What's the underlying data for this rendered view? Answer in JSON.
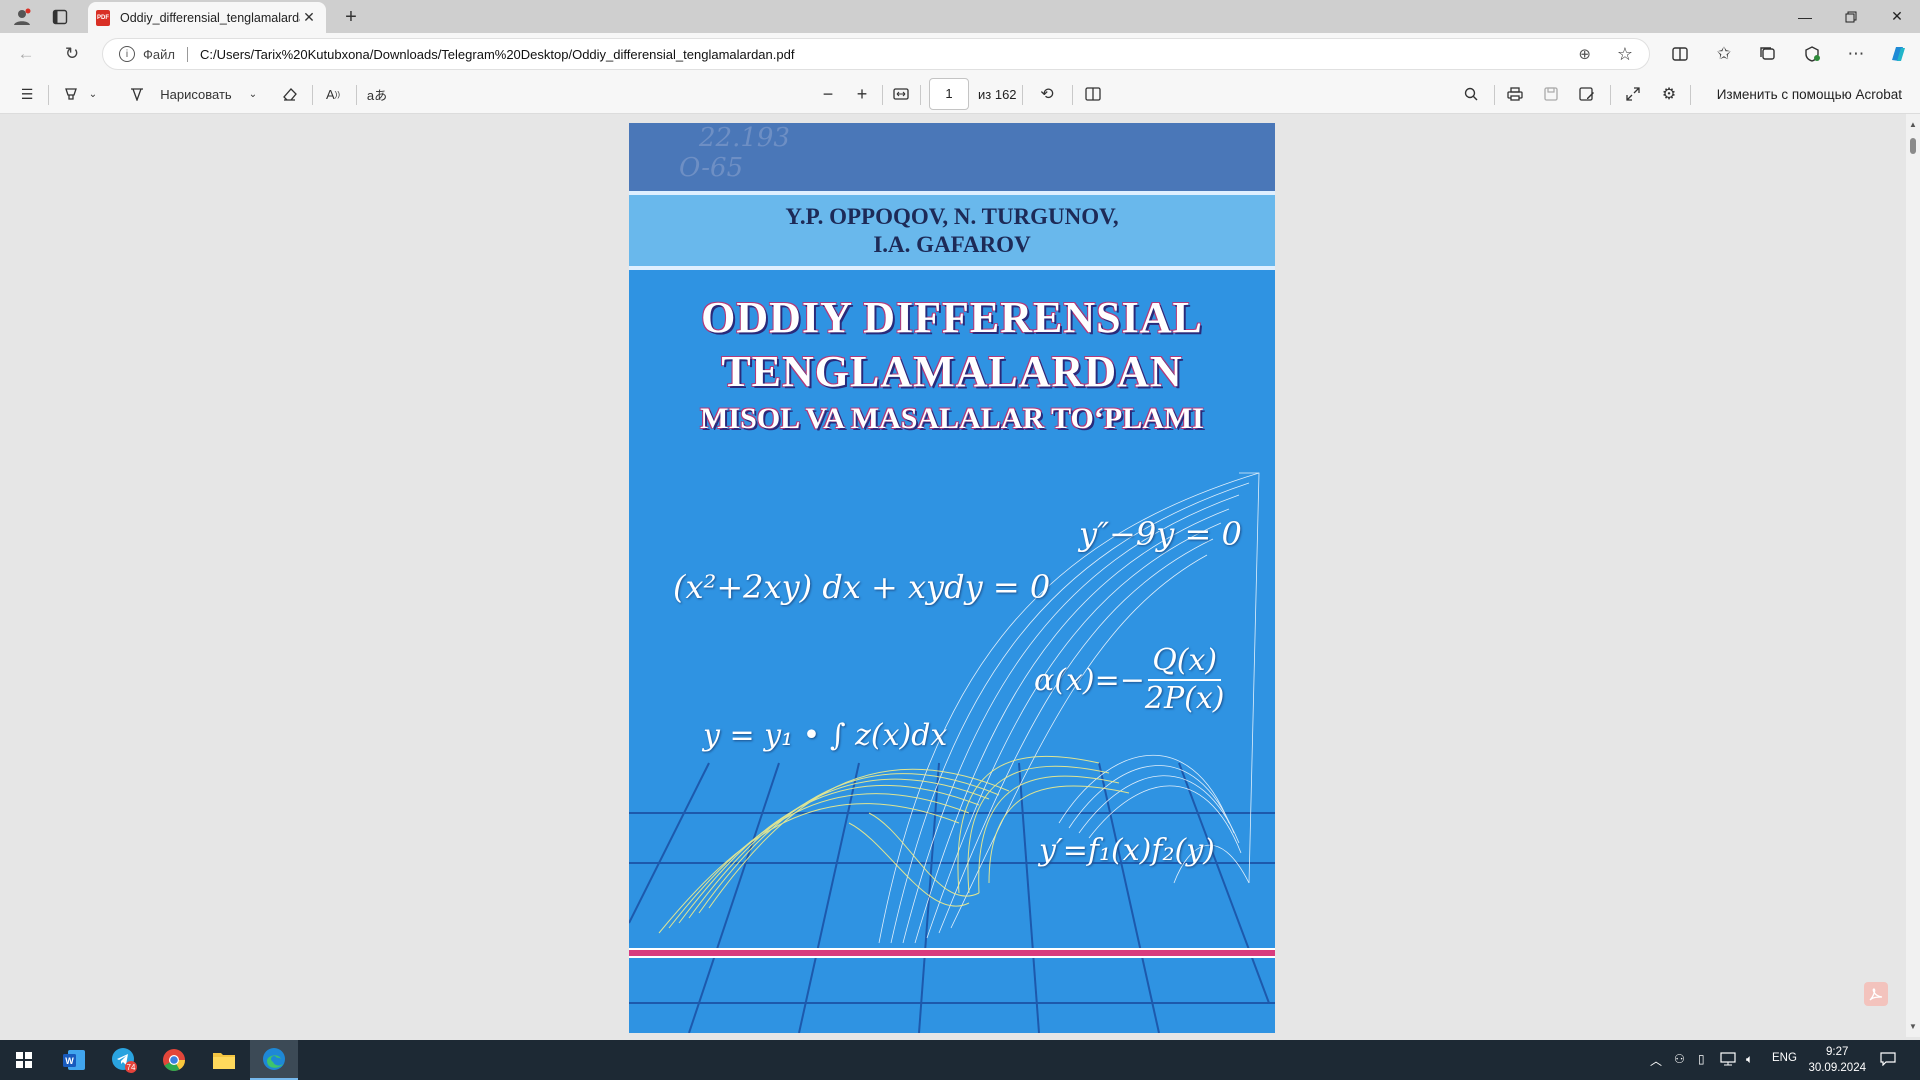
{
  "browser": {
    "tab_title": "Oddiy_differensial_tenglamalardan.pdf",
    "scheme_label": "Файл",
    "url": "C:/Users/Tarix%20Kutubxona/Downloads/Telegram%20Desktop/Oddiy_differensial_tenglamalardan.pdf"
  },
  "pdf_toolbar": {
    "draw_label": "Нарисовать",
    "page_current": "1",
    "page_total": "из 162",
    "edit_acrobat": "Изменить с помощью Acrobat"
  },
  "cover": {
    "handwritten_1": "22.193",
    "handwritten_2": "O-65",
    "authors_line1": "Y.P. OPPOQOV, N. TURGUNOV,",
    "authors_line2": "I.A. GAFAROV",
    "title_line1": "ODDIY DIFFERENSIAL",
    "title_line2": "TENGLAMALARDAN",
    "subtitle": "MISOL VA MASALALAR TO‘PLAMI",
    "eq1": "y″−9y = 0",
    "eq2": "(x²+2xy) dx + xydy = 0",
    "eq3_left": "α(x)=−",
    "eq3_num": "Q(x)",
    "eq3_den": "2P(x)",
    "eq4": "y = y₁ • ∫ z(x)dx",
    "eq5": "y′=f₁(x)f₂(y)"
  },
  "taskbar": {
    "telegram_badge": "74",
    "lang": "ENG",
    "time": "9:27",
    "date": "30.09.2024"
  },
  "colors": {
    "cover_blue": "#2f93e2",
    "cover_light_blue": "#69b8ec",
    "cover_pink": "#d93b7e",
    "taskbar": "#1d2934"
  }
}
